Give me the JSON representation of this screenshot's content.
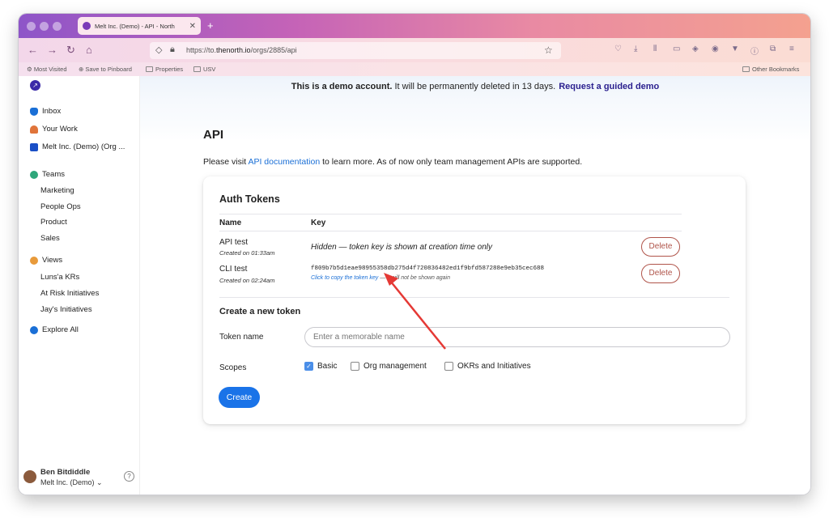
{
  "browser": {
    "tab_title": "Melt Inc. (Demo) - API - North",
    "tab_close": "✕",
    "new_tab": "+",
    "url_prefix": "https://to.",
    "url_domain": "thenorth.io",
    "url_path": "/orgs/2885/api",
    "bookmarks": [
      "Most Visited",
      "Save to Pinboard",
      "Properties",
      "USV"
    ],
    "other_bookmarks": "Other Bookmarks"
  },
  "sidebar": {
    "main_items": [
      {
        "label": "Inbox",
        "icon": "bell-icon",
        "color": "#1a6fd6"
      },
      {
        "label": "Your Work",
        "icon": "mountain-icon",
        "color": "#e0743a"
      },
      {
        "label": "Melt Inc. (Demo) (Org ...",
        "icon": "org-icon",
        "color": "#1a6fd6"
      }
    ],
    "teams_label": "Teams",
    "teams": [
      "Marketing",
      "People Ops",
      "Product",
      "Sales"
    ],
    "views_label": "Views",
    "views": [
      "Luns'a KRs",
      "At Risk Initiatives",
      "Jay's Initiatives"
    ],
    "explore_label": "Explore All",
    "user_name": "Ben Bitdiddle",
    "user_org": "Melt Inc. (Demo) ⌄",
    "help": "?"
  },
  "banner": {
    "bold": "This is a demo account.",
    "text": " It will be permanently deleted in 13 days.",
    "cta": "Request a guided demo"
  },
  "page": {
    "title": "API",
    "intro_before": "Please visit ",
    "intro_link": "API documentation",
    "intro_after": " to learn more. As of now only team management APIs are supported."
  },
  "tokens": {
    "title": "Auth Tokens",
    "col_name": "Name",
    "col_key": "Key",
    "rows": [
      {
        "name": "API test",
        "created": "Created on 01:33am",
        "hidden_text": "Hidden — token key is shown at creation time only",
        "delete": "Delete"
      },
      {
        "name": "CLI test",
        "created": "Created on 02:24am",
        "key": "f809b7b5d1eae98955358db275d4f720836482ed1f9bfd587288e9eb35cec688",
        "copy_link": "Click to copy the token key",
        "copy_note": " — it will not be shown again",
        "delete": "Delete"
      }
    ]
  },
  "create": {
    "title": "Create a new token",
    "token_name_label": "Token name",
    "token_name_placeholder": "Enter a memorable name",
    "scopes_label": "Scopes",
    "scopes": [
      {
        "label": "Basic",
        "checked": true
      },
      {
        "label": "Org management",
        "checked": false
      },
      {
        "label": "OKRs and Initiatives",
        "checked": false
      }
    ],
    "button": "Create"
  },
  "colors": {
    "accent": "#1a73e8",
    "delete": "#b0544a",
    "annotation_arrow": "#e53935"
  }
}
